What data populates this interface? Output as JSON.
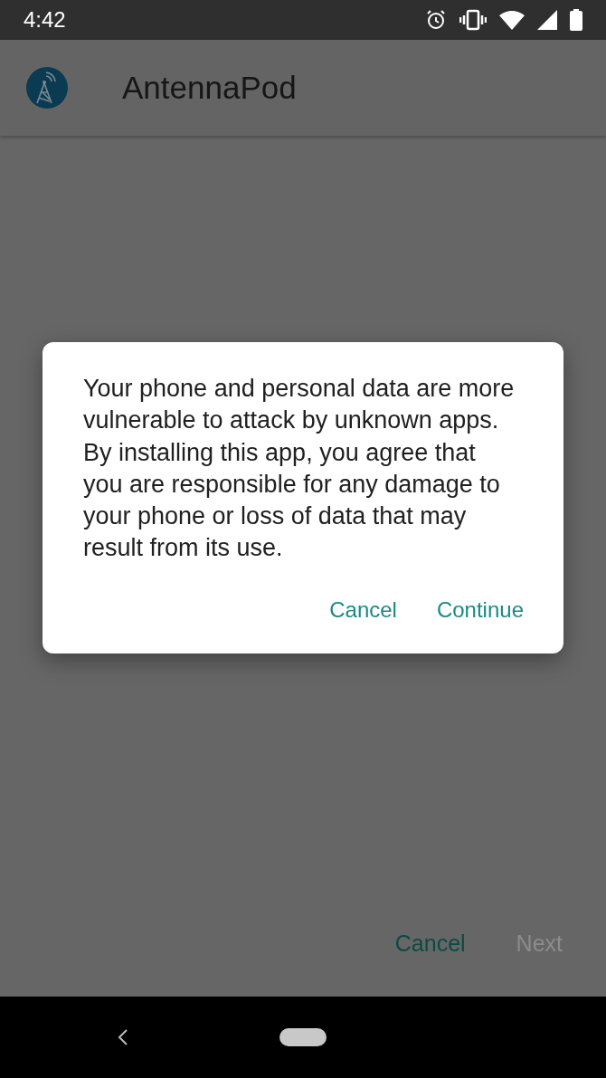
{
  "status_bar": {
    "time": "4:42"
  },
  "app_bar": {
    "title": "AntennaPod"
  },
  "footer_buttons": [
    {
      "label": "Cancel",
      "disabled": false
    },
    {
      "label": "Next",
      "disabled": true
    }
  ],
  "dialog": {
    "message": "Your phone and personal data are more vulnerable to attack by unknown apps. By installing this app, you agree that you are responsible for any damage to your phone or loss of data that may result from its use.",
    "buttons": [
      {
        "label": "Cancel"
      },
      {
        "label": "Continue"
      }
    ]
  }
}
